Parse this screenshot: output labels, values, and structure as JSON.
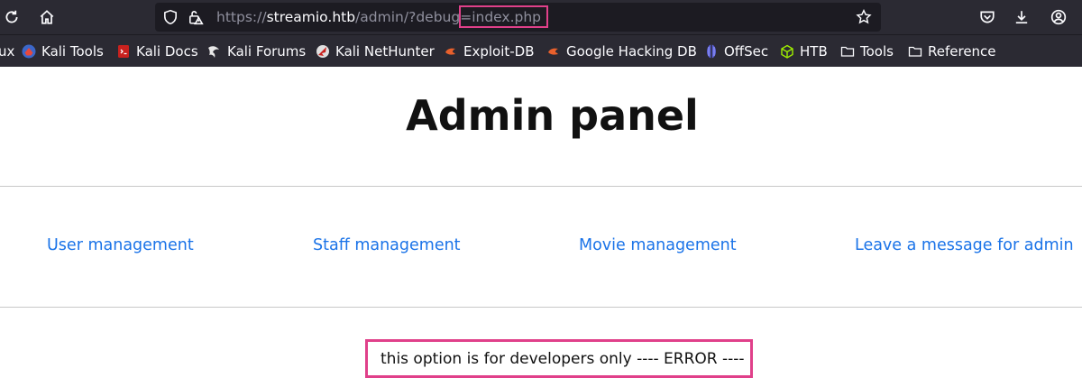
{
  "browser": {
    "url": {
      "scheme": "https://",
      "host": "streamio.htb",
      "path": "/admin/?debug=",
      "highlighted": "index.php"
    },
    "bookmarks": [
      {
        "label": "ux",
        "icon": "kali-dragon-icon"
      },
      {
        "label": "Kali Tools",
        "icon": "kali-tools-icon"
      },
      {
        "label": "Kali Docs",
        "icon": "kali-docs-icon"
      },
      {
        "label": "Kali Forums",
        "icon": "kali-forums-icon"
      },
      {
        "label": "Kali NetHunter",
        "icon": "nethunter-icon"
      },
      {
        "label": "Exploit-DB",
        "icon": "exploit-db-icon"
      },
      {
        "label": "Google Hacking DB",
        "icon": "ghdb-icon"
      },
      {
        "label": "OffSec",
        "icon": "offsec-icon"
      },
      {
        "label": "HTB",
        "icon": "htb-cube-icon"
      },
      {
        "label": "Tools",
        "icon": "folder-icon"
      },
      {
        "label": "Reference",
        "icon": "folder-icon"
      }
    ]
  },
  "page": {
    "title": "Admin panel",
    "nav": [
      "User management",
      "Staff management",
      "Movie management",
      "Leave a message for admin"
    ],
    "message": "this option is for developers only ---- ERROR ----"
  },
  "colors": {
    "chrome_bg": "#2b2a33",
    "urlbar_bg": "#1c1b22",
    "highlight": "#e0408a",
    "link": "#1a73e8"
  }
}
